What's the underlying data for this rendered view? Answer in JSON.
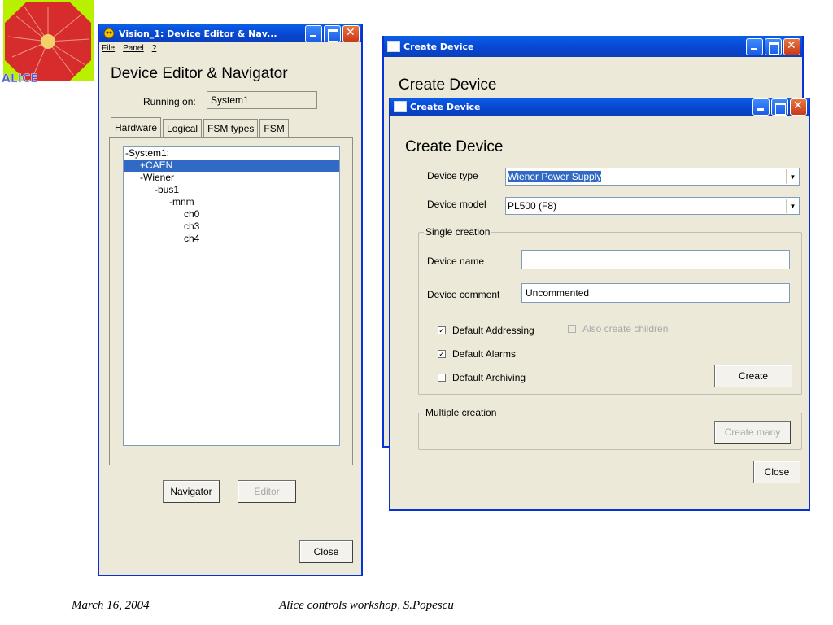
{
  "logo": {
    "text": "ALICE"
  },
  "editor": {
    "title": "Vision_1: Device Editor & Nav...",
    "menu": [
      "File",
      "Panel",
      "?"
    ],
    "heading": "Device Editor & Navigator",
    "running_on_label": "Running on:",
    "running_on_value": "System1",
    "tabs": [
      "Hardware",
      "Logical",
      "FSM types",
      "FSM"
    ],
    "active_tab": "Hardware",
    "tree": [
      {
        "label": "-System1:",
        "depth": 0,
        "selected": false
      },
      {
        "label": "+CAEN",
        "depth": 1,
        "selected": true
      },
      {
        "label": "-Wiener",
        "depth": 1,
        "selected": false
      },
      {
        "label": "-bus1",
        "depth": 2,
        "selected": false
      },
      {
        "label": "-mnm",
        "depth": 3,
        "selected": false
      },
      {
        "label": "ch0",
        "depth": 4,
        "selected": false
      },
      {
        "label": "ch3",
        "depth": 4,
        "selected": false
      },
      {
        "label": "ch4",
        "depth": 4,
        "selected": false
      }
    ],
    "navigator_button": "Navigator",
    "editor_button": "Editor",
    "close_button": "Close"
  },
  "create_back": {
    "title": "Create Device",
    "heading": "Create Device"
  },
  "create_front": {
    "title": "Create Device",
    "heading": "Create Device",
    "device_type_label": "Device type",
    "device_type_value": "Wiener Power Supply",
    "device_model_label": "Device model",
    "device_model_value": "PL500 (F8)",
    "single_group": "Single creation",
    "device_name_label": "Device name",
    "device_name_value": "",
    "device_comment_label": "Device comment",
    "device_comment_value": "Uncommented",
    "default_addressing": {
      "label": "Default Addressing",
      "checked": true
    },
    "also_create_children": {
      "label": "Also create children",
      "checked": false,
      "disabled": true
    },
    "default_alarms": {
      "label": "Default Alarms",
      "checked": true
    },
    "default_archiving": {
      "label": "Default Archiving",
      "checked": false
    },
    "create_button": "Create",
    "multiple_group": "Multiple creation",
    "create_many_button": "Create many",
    "close_button": "Close"
  },
  "footer": {
    "date": "March 16, 2004",
    "caption": "Alice controls workshop, S.Popescu"
  },
  "colors": {
    "titlebar": "#0846d0",
    "window_bg": "#ece9d8",
    "selection": "#316ac5"
  }
}
